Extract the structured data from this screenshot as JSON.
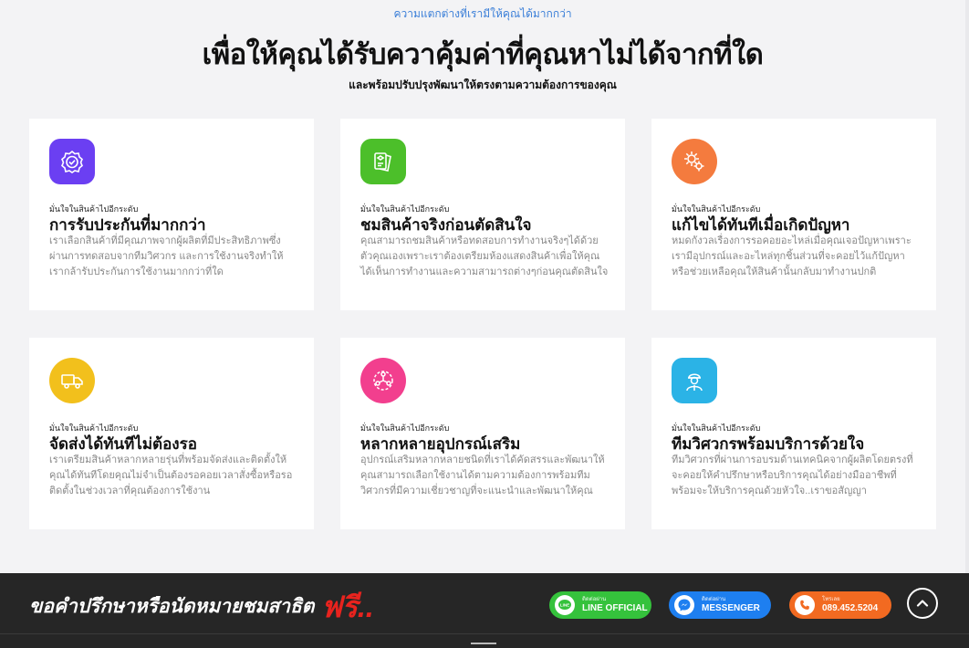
{
  "header": {
    "kicker": "ความแตกต่างที่เรามีให้คุณได้มากกว่า",
    "headline": "เพื่อให้คุณได้รับควาคุ้มค่าที่คุณหาไม่ได้จากที่ใด",
    "subhead": "และพร้อมปรับปรุงพัฒนาให้ตรงตามความต้องการของคุณ"
  },
  "cards": [
    {
      "eyebrow": "มั่นใจในสินค้าไปอีกระดับ",
      "title": "การรับประกันที่มากกว่า",
      "desc": "เราเลือกสินค้าที่มีคุณภาพจากผู้ผลิตที่มีประสิทธิภาพซึ่งผ่านการทดสอบจากทีมวิศวกร และการใช้งานจริงทำให้เรากล้ารับประกันการใช้งานมากกว่าที่ใด",
      "icon": "badge-check-icon",
      "color": "#6b3ff2"
    },
    {
      "eyebrow": "มั่นใจในสินค้าไปอีกระดับ",
      "title": "ชมสินค้าจริงก่อนตัดสินใจ",
      "desc": "คุณสามารถชมสินค้าหรือทดสอบการทำงานจริงๆได้ด้วยตัวคุณเองเพราะเราต้องเตรียมห้องแสดงสินค้าเพื่อให้คุณได้เห็นการทำงานและความสามารถต่างๆก่อนคุณตัดสินใจ",
      "icon": "product-cards-icon",
      "color": "#4cbf2a"
    },
    {
      "eyebrow": "มั่นใจในสินค้าไปอีกระดับ",
      "title": "แก้ไขได้ทันทีเมื่อเกิดปัญหา",
      "desc": "หมดกังวลเรื่องการรอคอยอะไหล่เมื่อคุณเจอปัญหาเพราะเรามีอุปกรณ์และอะไหล่ทุกชิ้นส่วนที่จะคอยไว้แก้ปัญหาหรือช่วยเหลือคุณให้สินค้านั้นกลับมาทำงานปกติ",
      "icon": "gears-icon",
      "color": "#f47b3e"
    },
    {
      "eyebrow": "มั่นใจในสินค้าไปอีกระดับ",
      "title": "จัดส่งได้ทันทีไม่ต้องรอ",
      "desc": "เราเตรียมสินค้าหลากหลายรุ่นที่พร้อมจัดส่งและติดตั้งให้คุณได้ทันทีโดยคุณไม่จำเป็นต้องรอคอยเวลาสั่งซื้อหรือรอติดตั้งในช่วงเวลาที่คุณต้องการใช้งาน",
      "icon": "delivery-truck-icon",
      "color": "#f2c01c"
    },
    {
      "eyebrow": "มั่นใจในสินค้าไปอีกระดับ",
      "title": "หลากหลายอุปกรณ์เสริม",
      "desc": "อุปกรณ์เสริมหลากหลายชนิดที่เราได้คัดสรรและพัฒนาให้คุณสามารถเลือกใช้งานได้ตามความต้องการพร้อมทีมวิศวกรที่มีความเชี่ยวชาญที่จะแนะนำและพัฒนาให้คุณ",
      "icon": "network-icon",
      "color": "#f23f8e"
    },
    {
      "eyebrow": "มั่นใจในสินค้าไปอีกระดับ",
      "title": "ทีมวิศวกรพร้อมบริการด้วยใจ",
      "desc": "ทีมวิศวกรที่ผ่านการอบรมด้านเทคนิคจากผู้ผลิตโดยตรงที่จะคอยให้คำปรึกษาหรือบริการคุณได้อย่างมืออาชีพที่พร้อมจะให้บริการคุณด้วยหัวใจ..เราขอสัญญา",
      "icon": "engineer-icon",
      "color": "#2bb3e6"
    }
  ],
  "footer": {
    "cta_text": "ขอคำปรึกษาหรือนัดหมายชมสาธิต",
    "cta_free": "ฟรี..",
    "line": {
      "small": "ติดต่อผ่าน",
      "label": "LINE OFFICIAL",
      "color": "#35c23c"
    },
    "messenger": {
      "small": "ติดต่อผ่าน",
      "label": "MESSENGER",
      "color": "#1e7ff0"
    },
    "phone": {
      "small": "โทรเลย",
      "label": "089.452.5204",
      "color": "#f26a21"
    }
  }
}
